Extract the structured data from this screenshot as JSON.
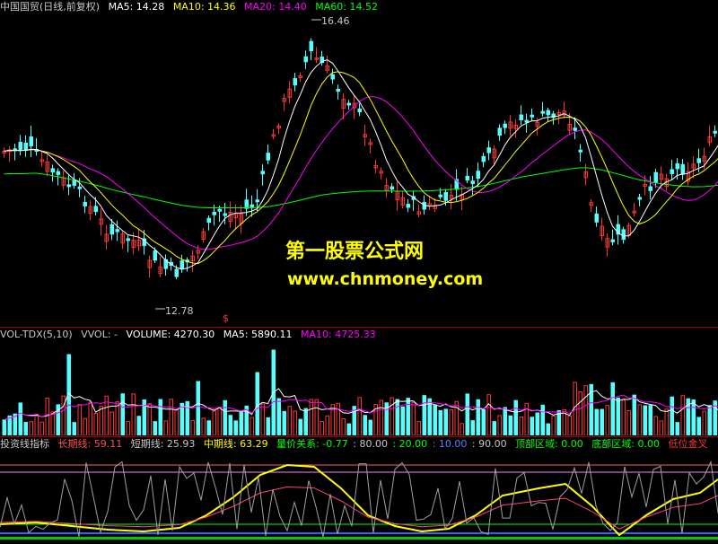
{
  "main": {
    "title": "中国国贸(日线,前复权)",
    "ma5_label": "MA5: 14.28",
    "ma10_label": "MA10: 14.36",
    "ma20_label": "MA20: 14.40",
    "ma60_label": "MA60: 14.52",
    "high_label": "16.46",
    "low_label": "12.78",
    "marker": "$",
    "colors": {
      "ma5": "#ffffff",
      "ma10": "#ffff00",
      "ma20": "#ff00ff",
      "ma60": "#00ff00",
      "up": "#ff3232",
      "down": "#54ffff"
    }
  },
  "watermark": {
    "line1": "第一股票公式网",
    "line2": "www.chnmoney.com"
  },
  "volume": {
    "title": "VOL-TDX(5,10)",
    "vvol": "VVOL: -",
    "volume_label": "VOLUME: 4270.30",
    "ma5_label": "MA5: 5890.11",
    "ma10_label": "MA10: 4725.33"
  },
  "indicator": {
    "title": "投资线指标",
    "long_label": "长期线: 59.11",
    "short_label": "短期线: 25.93",
    "mid_label": "中期线: 63.29",
    "vp_label": "量价关系: -0.77",
    "l80": ": 80.00",
    "l20": ": 20.00",
    "l10": ": 10.00",
    "l90": ": 90.00",
    "top_label": "顶部区域: 0.00",
    "bottom_label": "底部区域: 0.00",
    "cross_label": "低位金叉"
  }
}
